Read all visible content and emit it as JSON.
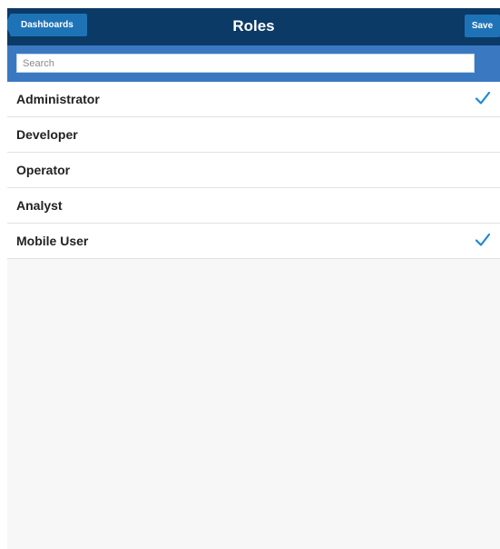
{
  "navbar": {
    "back_label": "Dashboards",
    "title": "Roles",
    "save_label": "Save"
  },
  "search": {
    "placeholder": "Search",
    "value": ""
  },
  "roles": [
    {
      "label": "Administrator",
      "selected": true
    },
    {
      "label": "Developer",
      "selected": false
    },
    {
      "label": "Operator",
      "selected": false
    },
    {
      "label": "Analyst",
      "selected": false
    },
    {
      "label": "Mobile User",
      "selected": true
    }
  ],
  "icons": {
    "check": "check-icon",
    "back": "chevron-left-icon"
  },
  "colors": {
    "navbar": "#0b3a66",
    "button": "#1e73b6",
    "search_bar": "#3a79c2",
    "check": "#1e88d6",
    "background": "#f7f7f7"
  }
}
